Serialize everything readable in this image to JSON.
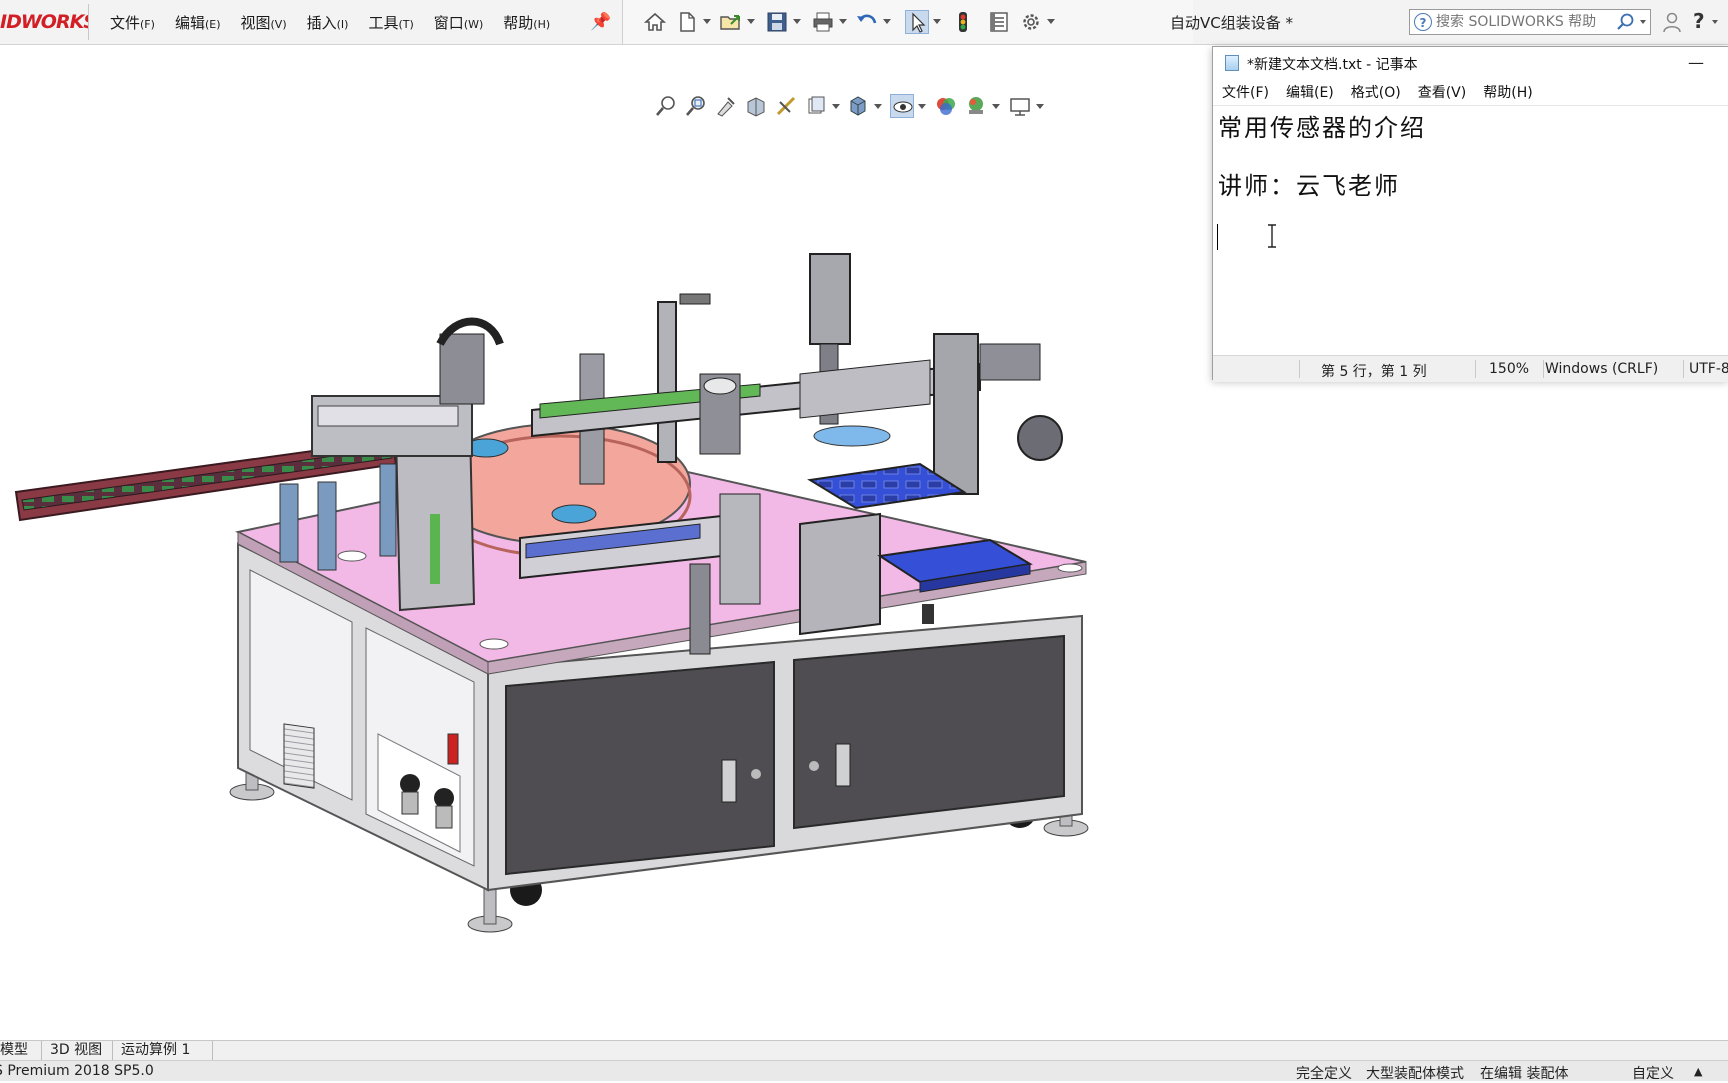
{
  "app": {
    "logo_text": "IDWORKS",
    "document_title": "自动VC组装设备 *",
    "menu": [
      {
        "label": "文件",
        "key": "(F)"
      },
      {
        "label": "编辑",
        "key": "(E)"
      },
      {
        "label": "视图",
        "key": "(V)"
      },
      {
        "label": "插入",
        "key": "(I)"
      },
      {
        "label": "工具",
        "key": "(T)"
      },
      {
        "label": "窗口",
        "key": "(W)"
      },
      {
        "label": "帮助",
        "key": "(H)"
      }
    ],
    "search_placeholder": "搜索 SOLIDWORKS 帮助",
    "help_label": "?"
  },
  "toolbar_icons": [
    "home-icon",
    "new-document-icon",
    "open-icon",
    "save-icon",
    "print-icon",
    "undo-icon",
    "select-icon",
    "rebuild-icon",
    "file-properties-icon",
    "options-icon"
  ],
  "view_toolbar_icons": [
    "zoom-to-fit-icon",
    "zoom-to-area-icon",
    "previous-view-icon",
    "section-view-icon",
    "dynamic-annotation-icon",
    "view-orientation-icon",
    "display-style-icon",
    "hide-show-icon",
    "edit-appearance-icon",
    "apply-scene-icon",
    "view-settings-icon"
  ],
  "notepad": {
    "title": "*新建文本文档.txt - 记事本",
    "minimize_label": "—",
    "menu": [
      "文件(F)",
      "编辑(E)",
      "格式(O)",
      "查看(V)",
      "帮助(H)"
    ],
    "lines": [
      "常用传感器的介绍",
      "",
      "讲师：云飞老师"
    ],
    "status": {
      "position": "第 5 行，第 1 列",
      "zoom": "150%",
      "line_ending": "Windows (CRLF)",
      "encoding": "UTF-8"
    }
  },
  "bottom_tabs": [
    "模型",
    "3D 视图",
    "运动算例 1"
  ],
  "status_bar": {
    "version": "S Premium 2018 SP5.0",
    "definition": "完全定义",
    "mode": "大型装配体模式",
    "editing": "在编辑 装配体",
    "custom": "自定义"
  },
  "colors": {
    "table_top": "#f2b8e6",
    "cabinet_frame": "#d9d9dc",
    "door_panel": "#4f4d52",
    "conveyor": "#8a3a44",
    "tray_blue": "#3550d6",
    "turntable": "#f3a79c",
    "logo_red": "#d21f26"
  }
}
